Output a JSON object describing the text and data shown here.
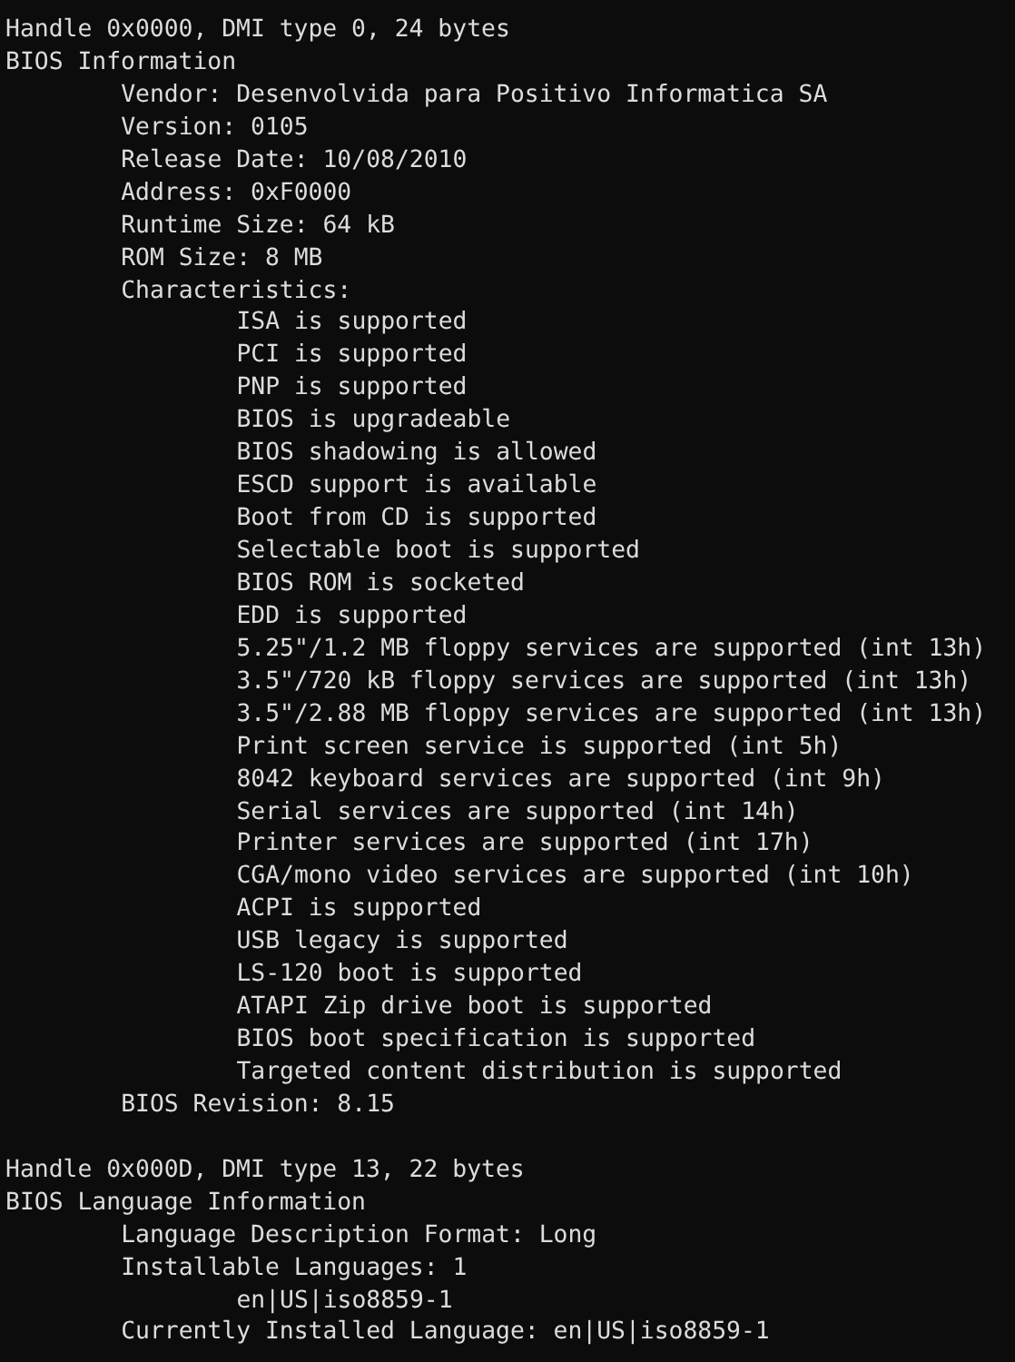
{
  "sections": [
    {
      "handle": "Handle 0x0000, DMI type 0, 24 bytes",
      "title": "BIOS Information",
      "children": [
        {
          "text": "Vendor: Desenvolvida para Positivo Informatica SA"
        },
        {
          "text": "Version: 0105"
        },
        {
          "text": "Release Date: 10/08/2010"
        },
        {
          "text": "Address: 0xF0000"
        },
        {
          "text": "Runtime Size: 64 kB"
        },
        {
          "text": "ROM Size: 8 MB"
        },
        {
          "text": "Characteristics:",
          "children": [
            {
              "text": "ISA is supported"
            },
            {
              "text": "PCI is supported"
            },
            {
              "text": "PNP is supported"
            },
            {
              "text": "BIOS is upgradeable"
            },
            {
              "text": "BIOS shadowing is allowed"
            },
            {
              "text": "ESCD support is available"
            },
            {
              "text": "Boot from CD is supported"
            },
            {
              "text": "Selectable boot is supported"
            },
            {
              "text": "BIOS ROM is socketed"
            },
            {
              "text": "EDD is supported"
            },
            {
              "text": "5.25\"/1.2 MB floppy services are supported (int 13h)"
            },
            {
              "text": "3.5\"/720 kB floppy services are supported (int 13h)"
            },
            {
              "text": "3.5\"/2.88 MB floppy services are supported (int 13h)"
            },
            {
              "text": "Print screen service is supported (int 5h)"
            },
            {
              "text": "8042 keyboard services are supported (int 9h)"
            },
            {
              "text": "Serial services are supported (int 14h)"
            },
            {
              "text": "Printer services are supported (int 17h)"
            },
            {
              "text": "CGA/mono video services are supported (int 10h)"
            },
            {
              "text": "ACPI is supported"
            },
            {
              "text": "USB legacy is supported"
            },
            {
              "text": "LS-120 boot is supported"
            },
            {
              "text": "ATAPI Zip drive boot is supported"
            },
            {
              "text": "BIOS boot specification is supported"
            },
            {
              "text": "Targeted content distribution is supported"
            }
          ]
        },
        {
          "text": "BIOS Revision: 8.15"
        }
      ]
    },
    {
      "handle": "Handle 0x000D, DMI type 13, 22 bytes",
      "title": "BIOS Language Information",
      "children": [
        {
          "text": "Language Description Format: Long"
        },
        {
          "text": "Installable Languages: 1",
          "children": [
            {
              "text": "en|US|iso8859-1"
            }
          ]
        },
        {
          "text": "Currently Installed Language: en|US|iso8859-1"
        }
      ]
    }
  ]
}
